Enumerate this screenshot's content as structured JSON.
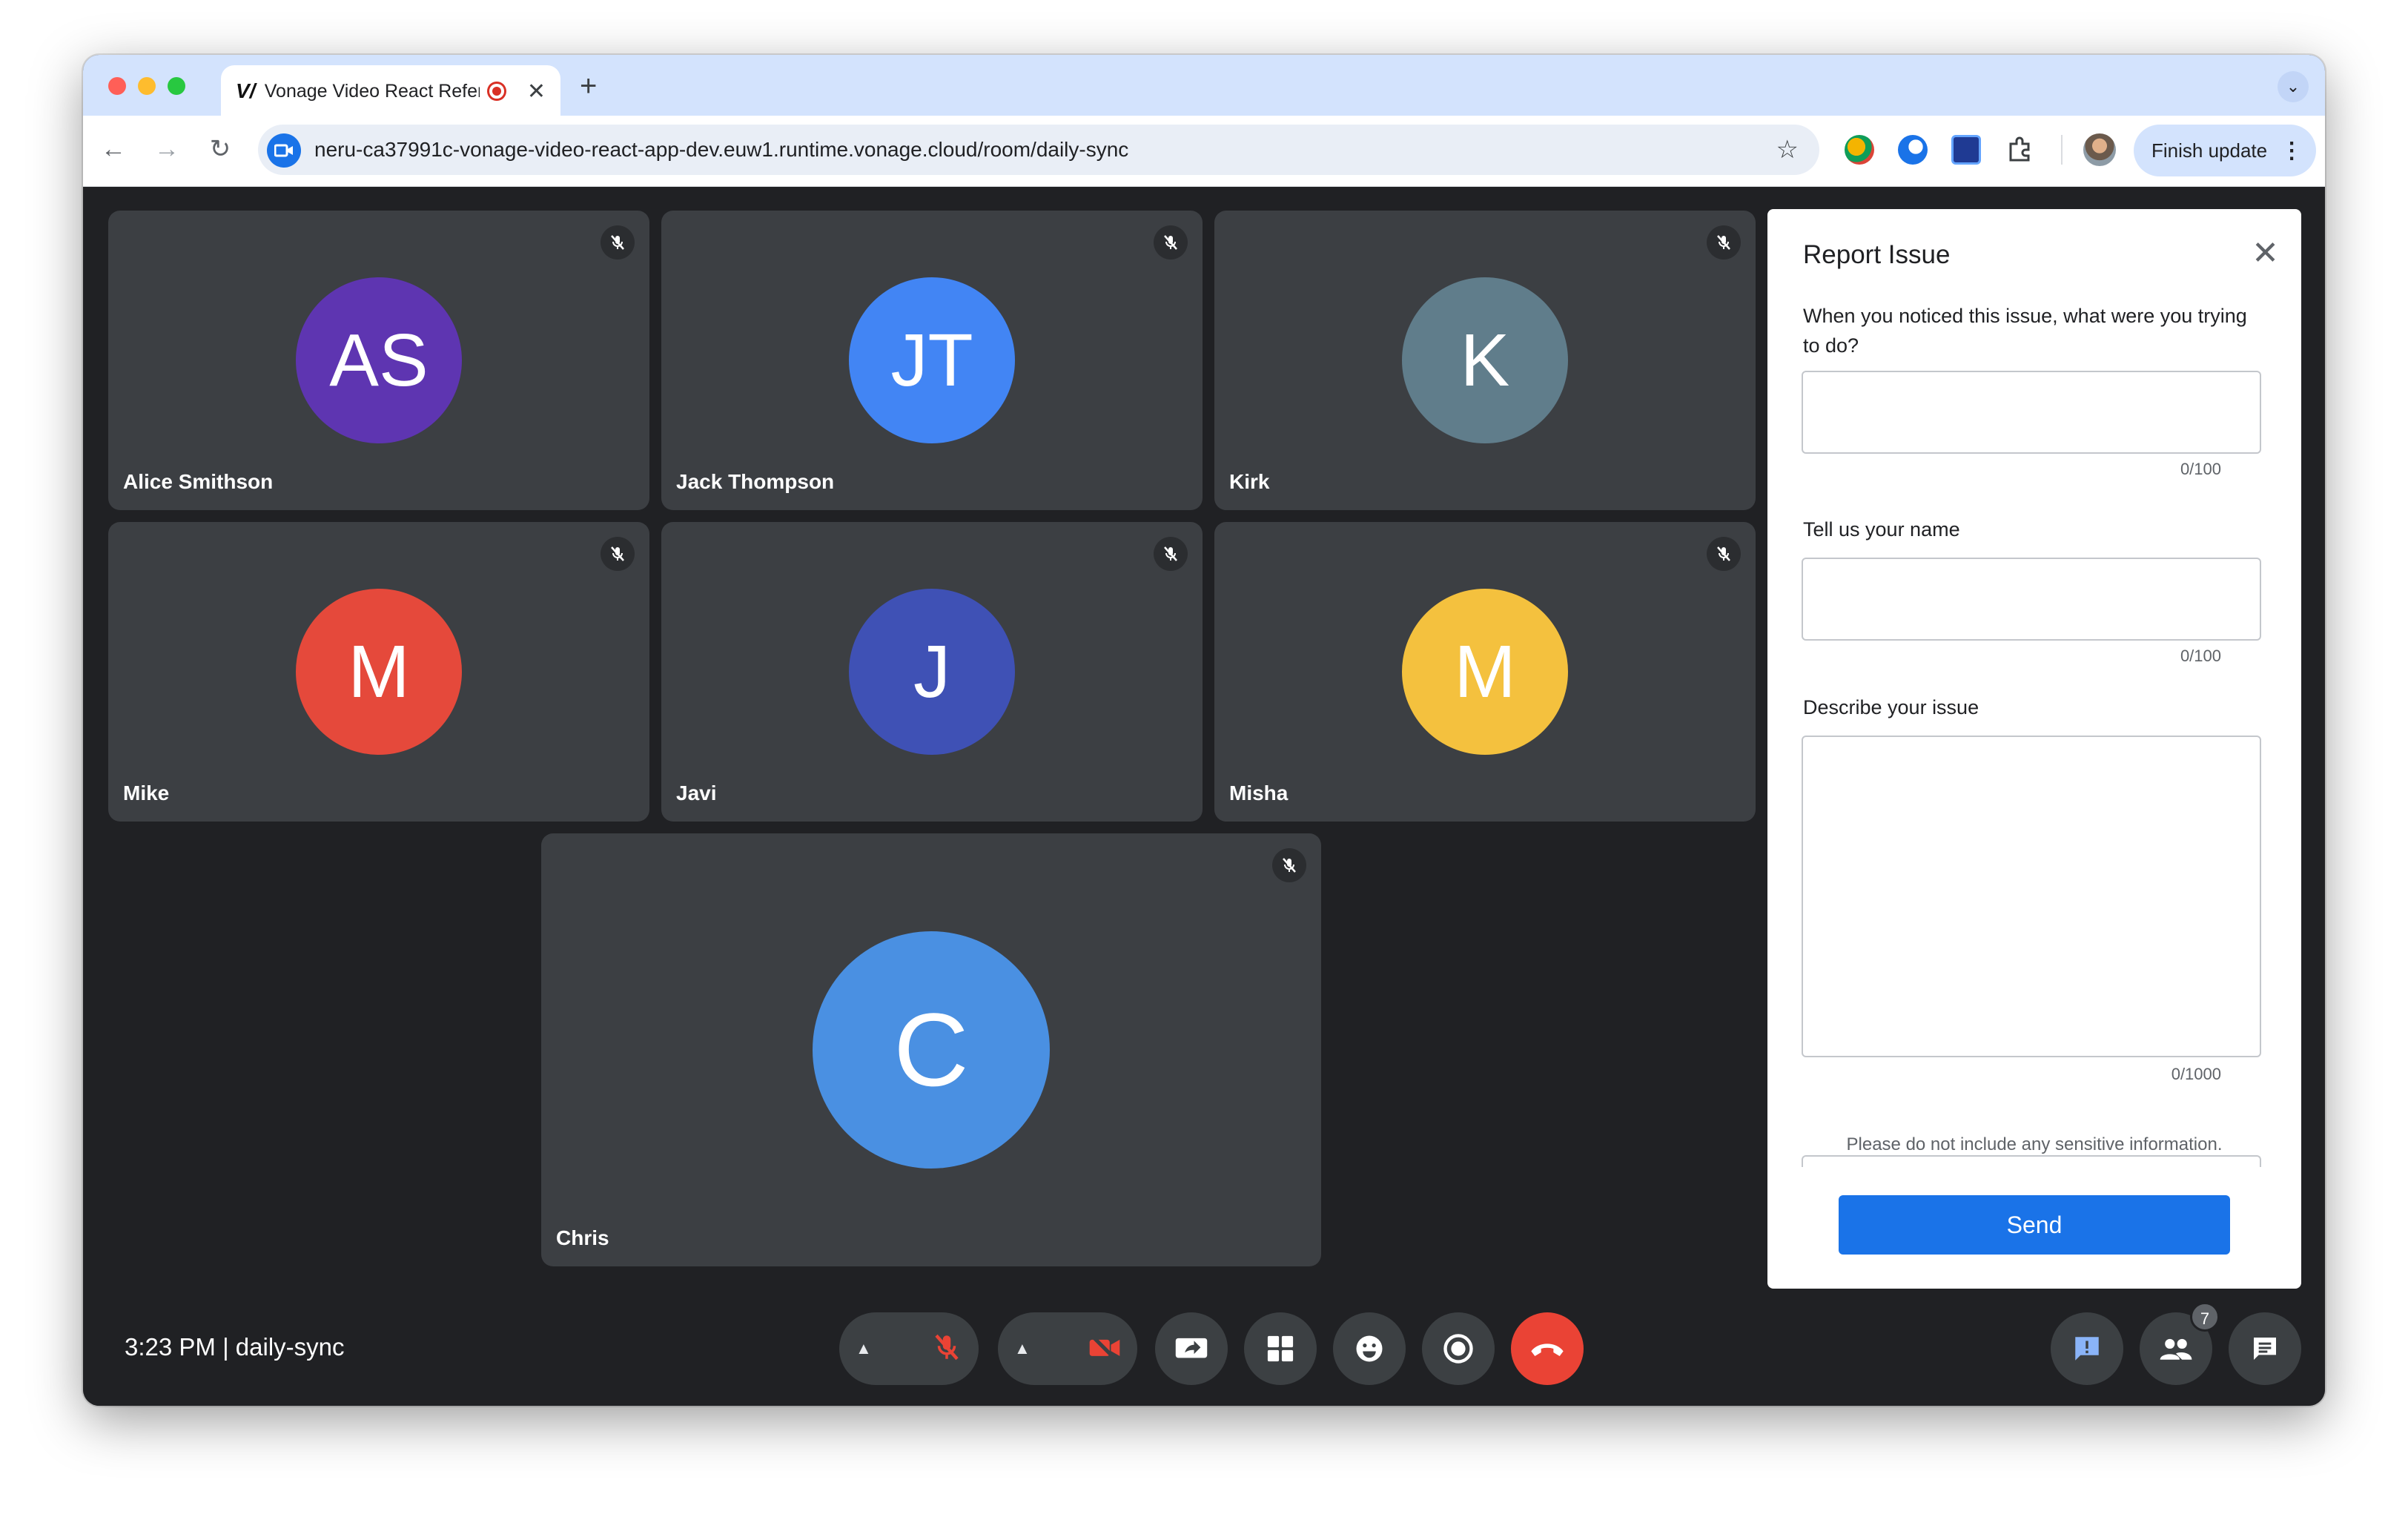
{
  "browser": {
    "tab_title": "Vonage Video React Refer",
    "url": "neru-ca37991c-vonage-video-react-app-dev.euw1.runtime.vonage.cloud/room/daily-sync",
    "finish_update_label": "Finish update",
    "tab_favicon": "V/"
  },
  "participants": [
    {
      "name": "Alice Smithson",
      "initials": "AS",
      "color": "#5e35b1"
    },
    {
      "name": "Jack Thompson",
      "initials": "JT",
      "color": "#4285f4"
    },
    {
      "name": "Kirk",
      "initials": "K",
      "color": "#607d8b"
    },
    {
      "name": "Mike",
      "initials": "M",
      "color": "#e5493b"
    },
    {
      "name": "Javi",
      "initials": "J",
      "color": "#3f51b5"
    },
    {
      "name": "Misha",
      "initials": "M",
      "color": "#f4c13e"
    },
    {
      "name": "Chris",
      "initials": "C",
      "color": "#4a90e2"
    }
  ],
  "report_issue": {
    "title": "Report Issue",
    "q1_label": "When you noticed this issue, what were you trying to do?",
    "q1_value": "",
    "q1_count": "0/100",
    "q2_label": "Tell us your name",
    "q2_value": "",
    "q2_count": "0/100",
    "q3_label": "Describe your issue",
    "q3_value": "",
    "q3_count": "0/1000",
    "notice": "Please do not include any sensitive information.",
    "send_label": "Send"
  },
  "meeting": {
    "info": "3:23 PM | daily-sync",
    "participant_count": "7"
  },
  "controls": [
    "mic-options",
    "mic-off",
    "video-options",
    "video-off",
    "screen-share",
    "layout",
    "emoji",
    "record",
    "leave-call"
  ],
  "colors": {
    "leave": "#ea4335",
    "accent": "#1a73e8",
    "muted_icon": "#ea4335"
  }
}
